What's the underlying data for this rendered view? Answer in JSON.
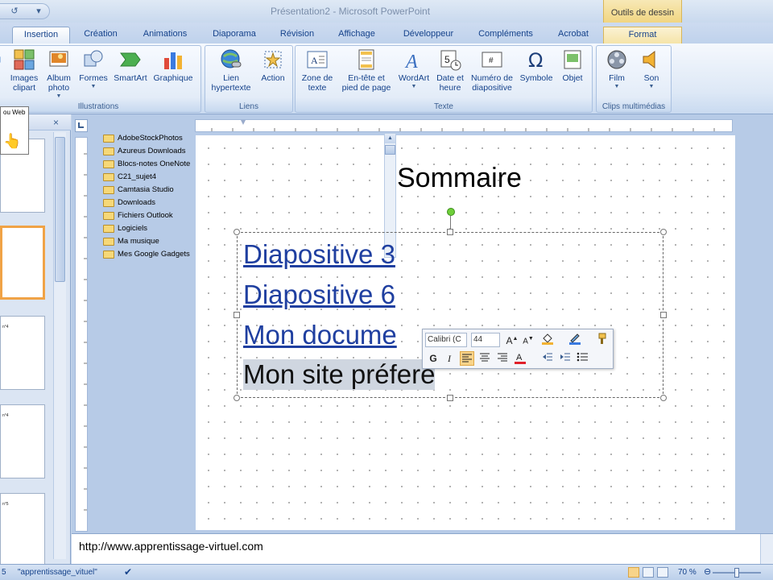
{
  "window": {
    "title": "Présentation2 - Microsoft PowerPoint",
    "context_title": "Outils de dessin"
  },
  "qat": {
    "undo": "↺",
    "more": "▾"
  },
  "tabs": [
    {
      "label": "Insertion"
    },
    {
      "label": "Création"
    },
    {
      "label": "Animations"
    },
    {
      "label": "Diaporama"
    },
    {
      "label": "Révision"
    },
    {
      "label": "Affichage"
    },
    {
      "label": "Développeur"
    },
    {
      "label": "Compléments"
    },
    {
      "label": "Acrobat"
    },
    {
      "label": "Format"
    }
  ],
  "ribbon": {
    "illustrations": {
      "label": "Illustrations",
      "images_clipart": "Images clipart",
      "album_photo": "Album photo",
      "formes": "Formes",
      "smartart": "SmartArt",
      "graphique": "Graphique"
    },
    "liens": {
      "label": "Liens",
      "lien_hypertexte": "Lien hypertexte",
      "action": "Action"
    },
    "texte": {
      "label": "Texte",
      "zone_de_texte": "Zone de texte",
      "entete": "En-tête et pied de page",
      "wordart": "WordArt",
      "date_heure": "Date et heure",
      "numero": "Numéro de diapositive",
      "symbole": "Symbole",
      "objet": "Objet"
    },
    "clips": {
      "label": "Clips multimédias",
      "film": "Film",
      "son": "Son"
    }
  },
  "slides_panel": {
    "close": "×",
    "tooltip": "ou Web",
    "thumb_labels": [
      "",
      "",
      "n°4",
      "n°4",
      "n°5"
    ]
  },
  "folders": [
    "AdobeStockPhotos",
    "Azureus Downloads",
    "Blocs-notes OneNote",
    "C21_sujet4",
    "Camtasia Studio",
    "Downloads",
    "Fichiers Outlook",
    "Logiciels",
    "Ma musique",
    "Mes Google Gadgets"
  ],
  "slide": {
    "title": "Sommaire",
    "bullets": [
      {
        "text": "Diapositive 3",
        "kind": "link"
      },
      {
        "text": "Diapositive 6",
        "kind": "link"
      },
      {
        "text": "Mon docume",
        "kind": "link"
      },
      {
        "text": "Mon site préfere",
        "kind": "plain"
      }
    ]
  },
  "mini_toolbar": {
    "font": "Calibri (C",
    "size": "44",
    "bold": "G",
    "italic": "I"
  },
  "notes": {
    "text": "http://www.apprentissage-virtuel.com"
  },
  "status": {
    "slide": "5",
    "theme": "\"apprentissage_vituel\"",
    "zoom": "70 %"
  }
}
